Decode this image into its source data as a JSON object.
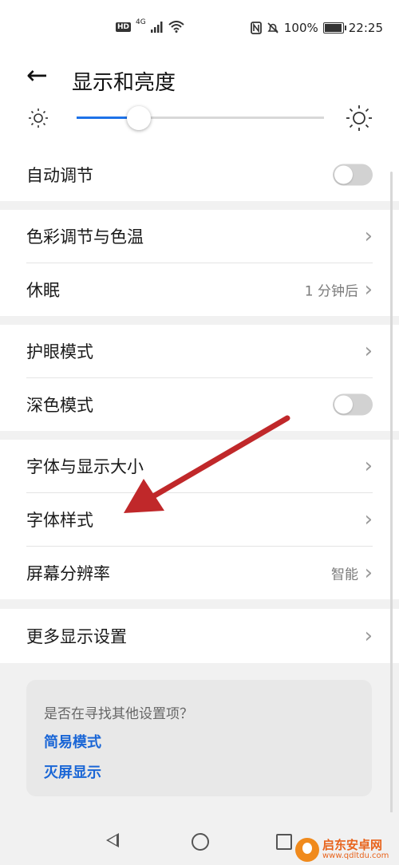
{
  "status_bar": {
    "hd": "HD",
    "net": "4G",
    "battery_text": "100%",
    "battery_level": 1.0,
    "time": "22:25"
  },
  "header": {
    "title": "显示和亮度"
  },
  "brightness": {
    "level": 0.25
  },
  "auto_adjust": {
    "label": "自动调节",
    "on": false
  },
  "group1": [
    {
      "label": "色彩调节与色温",
      "value": ""
    },
    {
      "label": "休眠",
      "value": "1 分钟后"
    }
  ],
  "group2": {
    "eye_care": "护眼模式",
    "dark_mode": {
      "label": "深色模式",
      "on": false
    }
  },
  "group3": [
    {
      "label": "字体与显示大小",
      "value": ""
    },
    {
      "label": "字体样式",
      "value": ""
    },
    {
      "label": "屏幕分辨率",
      "value": "智能"
    }
  ],
  "more_display": "更多显示设置",
  "suggestion": {
    "question": "是否在寻找其他设置项？",
    "links": [
      "简易模式",
      "灭屏显示"
    ]
  },
  "watermark": {
    "name": "启东安卓网",
    "url": "www.qdltdu.com"
  },
  "colors": {
    "accent": "#1e72e8",
    "link": "#1a66d6",
    "arrow": "#c0282a"
  }
}
